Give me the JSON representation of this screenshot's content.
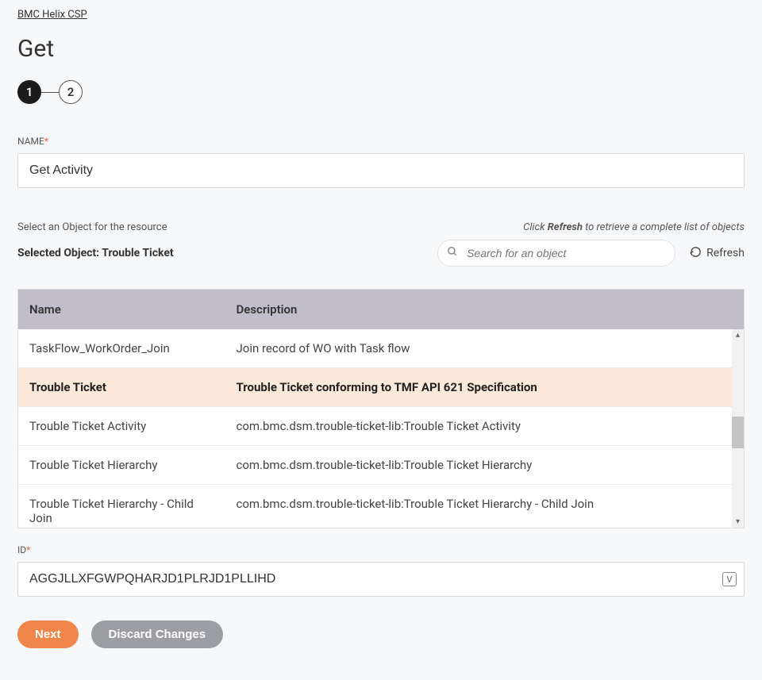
{
  "breadcrumb": "BMC Helix CSP",
  "page_title": "Get",
  "steps": {
    "step1": "1",
    "step2": "2"
  },
  "name_field": {
    "label": "NAME",
    "required": "*",
    "value": "Get Activity"
  },
  "hint_left": "Select an Object for the resource",
  "hint_right_prefix": "Click ",
  "hint_right_bold": "Refresh",
  "hint_right_suffix": " to retrieve a complete list of objects",
  "selected_prefix": "Selected Object: ",
  "selected_object": "Trouble Ticket",
  "search": {
    "placeholder": "Search for an object"
  },
  "refresh_label": "Refresh",
  "table": {
    "col_name": "Name",
    "col_desc": "Description",
    "rows": [
      {
        "name": "TaskFlow_WorkOrder_Join",
        "desc": "Join record of WO with Task flow"
      },
      {
        "name": "Trouble Ticket",
        "desc": "Trouble Ticket conforming to TMF API 621 Specification"
      },
      {
        "name": "Trouble Ticket Activity",
        "desc": "com.bmc.dsm.trouble-ticket-lib:Trouble Ticket Activity"
      },
      {
        "name": "Trouble Ticket Hierarchy",
        "desc": "com.bmc.dsm.trouble-ticket-lib:Trouble Ticket Hierarchy"
      },
      {
        "name": "Trouble Ticket Hierarchy - Child Join",
        "desc": "com.bmc.dsm.trouble-ticket-lib:Trouble Ticket Hierarchy - Child Join"
      }
    ],
    "selected_index": 1
  },
  "id_field": {
    "label": "ID",
    "required": "*",
    "value": "AGGJLLXFGWPQHARJD1PLRJD1PLLIHD",
    "suffix_icon": "V"
  },
  "buttons": {
    "next": "Next",
    "discard": "Discard Changes"
  }
}
